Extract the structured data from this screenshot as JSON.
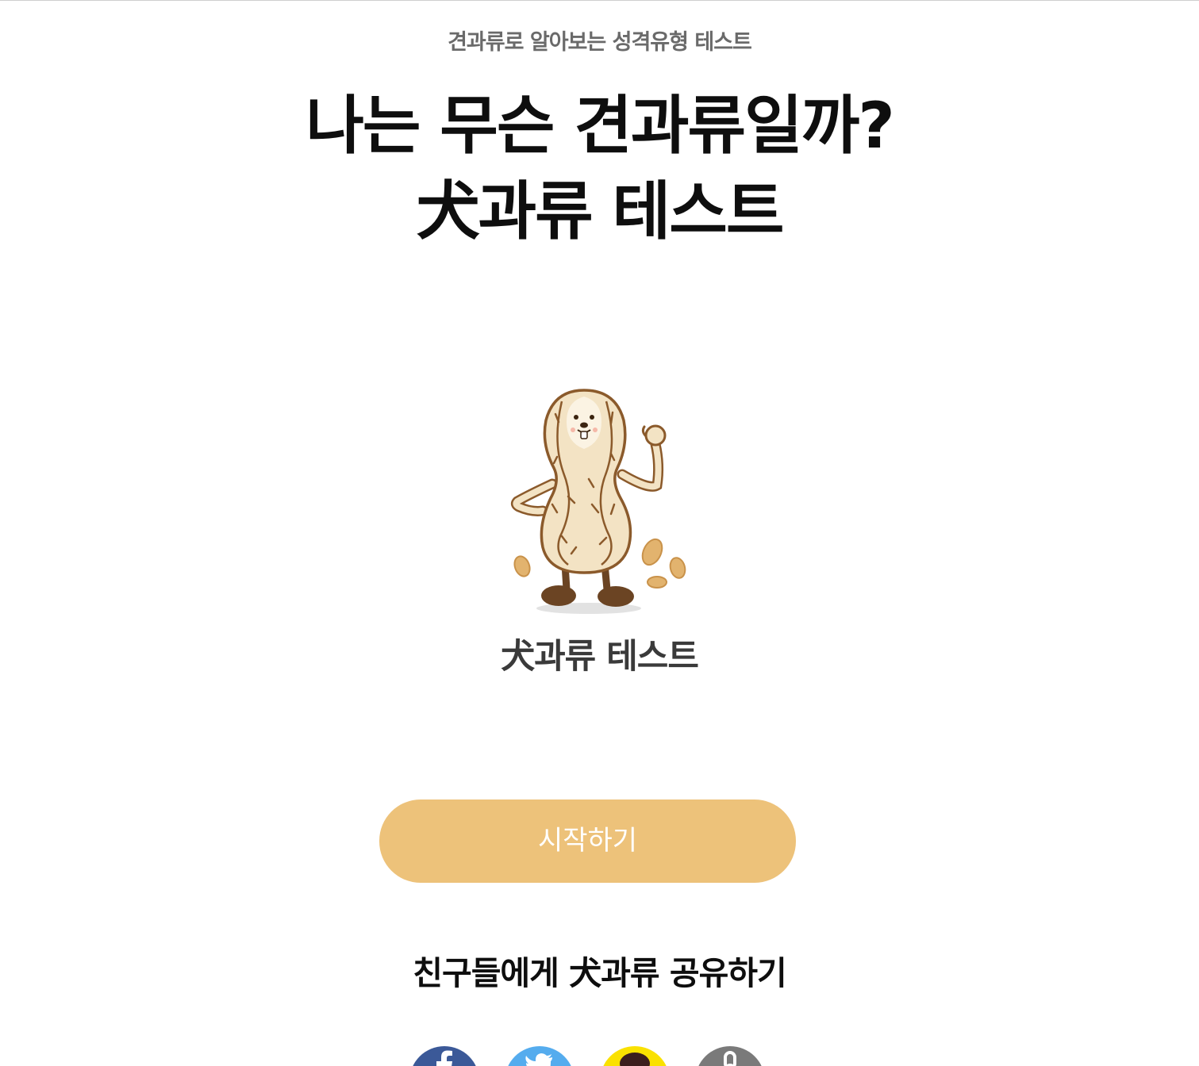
{
  "header": {
    "subtitle": "견과류로 알아보는 성격유형 테스트",
    "headline_line1": "나는 무슨 견과류일까?",
    "headline_line2": "犬과류 테스트"
  },
  "mascot": {
    "icon": "peanut-dog-mascot",
    "caption": "犬과류 테스트"
  },
  "actions": {
    "start_label": "시작하기",
    "start_color": "#edc27a"
  },
  "share": {
    "title": "친구들에게 犬과류 공유하기",
    "buttons": [
      {
        "icon": "facebook-icon",
        "color": "#3b5998"
      },
      {
        "icon": "twitter-icon",
        "color": "#55acee"
      },
      {
        "icon": "kakaotalk-icon",
        "color": "#fae100"
      },
      {
        "icon": "link-icon",
        "color": "#7a7a7a"
      }
    ]
  }
}
